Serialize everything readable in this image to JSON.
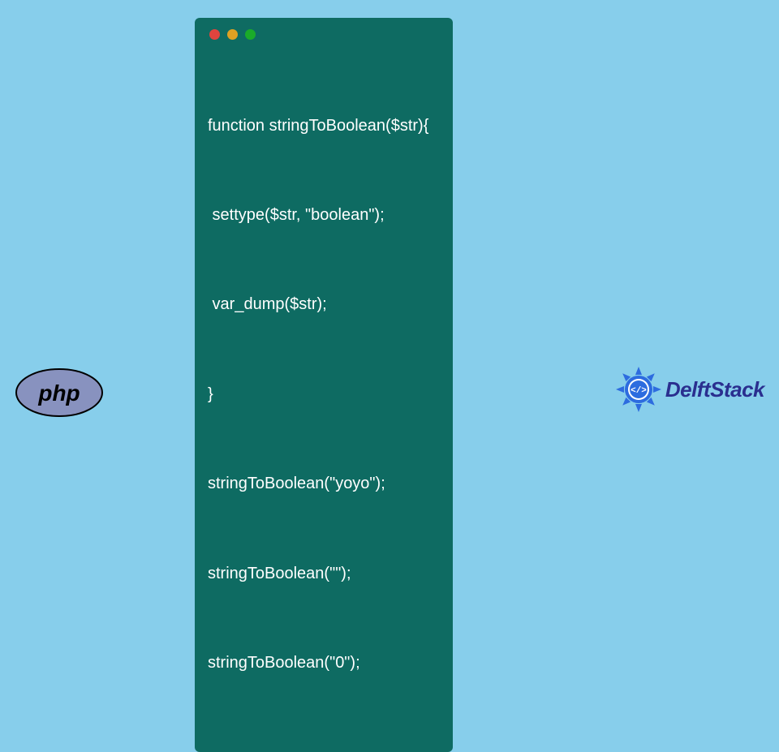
{
  "code": {
    "lines": [
      "function stringToBoolean($str){",
      " settype($str, \"boolean\");",
      " var_dump($str);",
      "}",
      "stringToBoolean(\"yoyo\");",
      "stringToBoolean(\"\");",
      "stringToBoolean(\"0\");"
    ]
  },
  "logos": {
    "php": "php",
    "delft": "DelftStack"
  },
  "colors": {
    "page_bg": "#87ceeb",
    "window_bg": "#0e6b62",
    "code_text": "#ffffff",
    "php_ellipse": "#8892bf",
    "php_text": "#000000",
    "delft_text": "#2a2f8f",
    "delft_badge": "#2d6cdf",
    "dot_red": "#e0443e",
    "dot_yellow": "#dea123",
    "dot_green": "#1aab29"
  }
}
